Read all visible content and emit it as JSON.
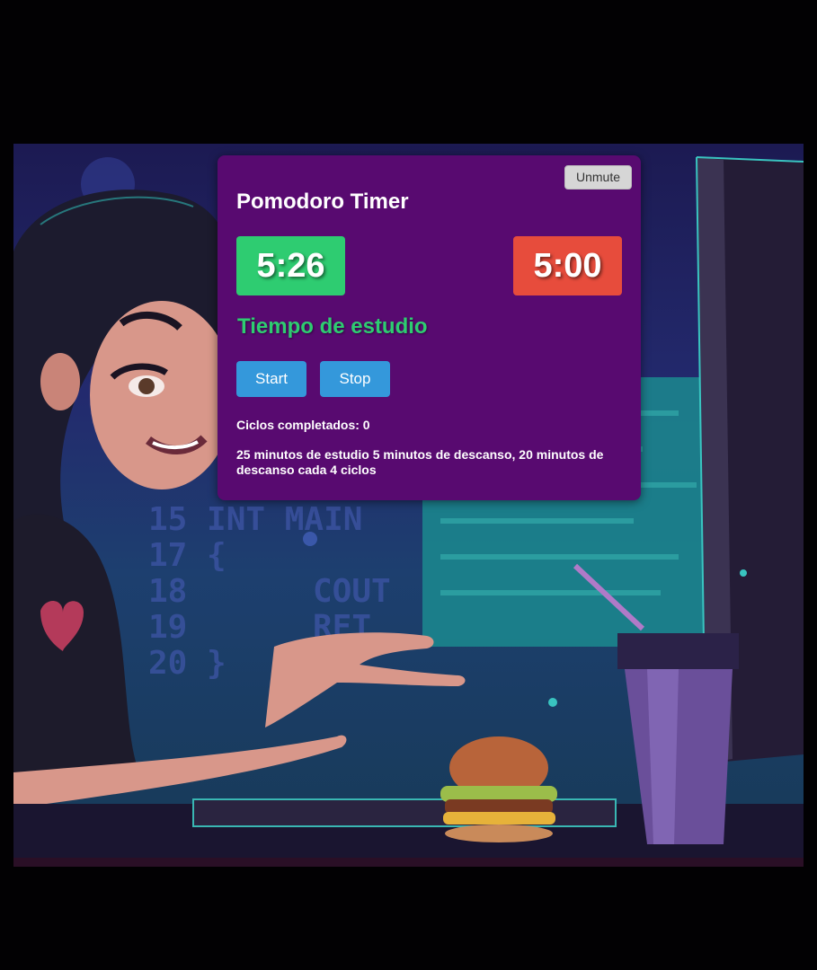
{
  "background": {
    "code_lines": [
      "15 INT MAIN",
      "17 {",
      "18",
      "19",
      "20 }"
    ],
    "code_words": [
      "COUT",
      "RET"
    ]
  },
  "pomodoro": {
    "mute_label": "Unmute",
    "title": "Pomodoro Timer",
    "study_time": "5:26",
    "break_time": "5:00",
    "mode_label": "Tiempo de estudio",
    "start_label": "Start",
    "stop_label": "Stop",
    "cycles_text": "Ciclos completados: 0",
    "info_text": "25 minutos de estudio 5 minutos de descanso, 20 minutos de descanso cada 4 ciclos",
    "colors": {
      "panel": "#580a70",
      "study": "#2ecc71",
      "break": "#e74c3c",
      "button": "#3498db"
    }
  }
}
